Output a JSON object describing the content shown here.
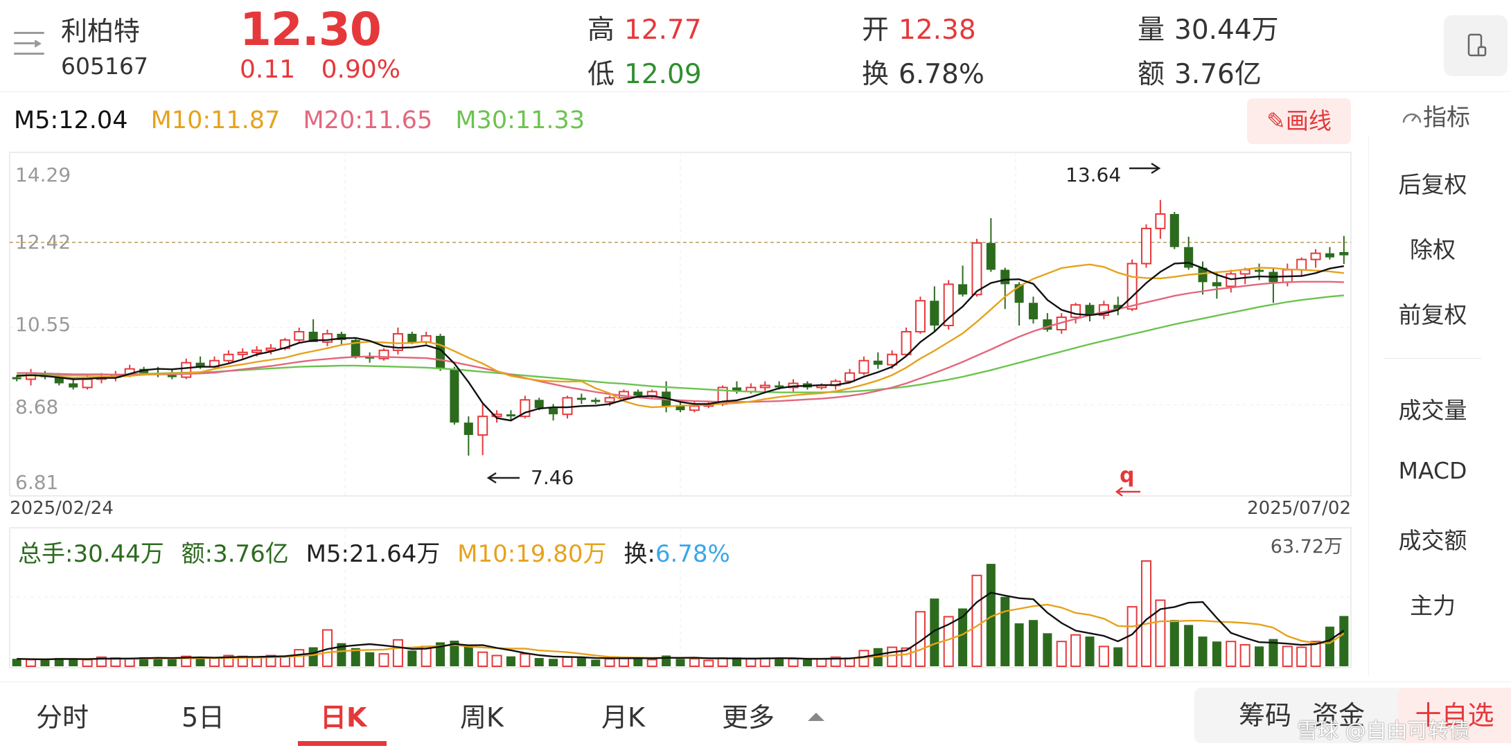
{
  "stock": {
    "name": "利柏特",
    "code": "605167",
    "price": "12.30",
    "change": "0.11",
    "change_pct": "0.90%"
  },
  "stats": {
    "high_label": "高",
    "high": "12.77",
    "low_label": "低",
    "low": "12.09",
    "open_label": "开",
    "open": "12.38",
    "turnover_label": "换",
    "turnover": "6.78%",
    "volume_label": "量",
    "volume": "30.44万",
    "amount_label": "额",
    "amount": "3.76亿"
  },
  "ma": {
    "m5": "M5:12.04",
    "m10": "M10:11.87",
    "m20": "M20:11.65",
    "m30": "M30:11.33"
  },
  "tools": {
    "draw_label": "画线",
    "index_label": "指标"
  },
  "side_panel": {
    "items": [
      "后复权",
      "除权",
      "前复权",
      "成交量",
      "MACD",
      "成交额",
      "主力"
    ],
    "active": [
      "前复权",
      "成交量"
    ]
  },
  "volume_panel": {
    "total": "总手:30.44万",
    "amount": "额:3.76亿",
    "m5": "M5:21.64万",
    "m10": "M10:19.80万",
    "turnover_label": "换:",
    "turnover_value": "6.78%",
    "max_label": "63.72万"
  },
  "tabs": [
    {
      "label": "分时"
    },
    {
      "label": "5日"
    },
    {
      "label": "日K"
    },
    {
      "label": "周K"
    },
    {
      "label": "月K"
    },
    {
      "label": "更多"
    }
  ],
  "bottom_buttons": {
    "chips": "筹码",
    "funds": "资金",
    "watchlist": "十自选"
  },
  "watermark": "雪球 @自由可转债",
  "colors": {
    "up": "#e5383b",
    "down": "#2c6b1e",
    "ma5": "#111111",
    "ma10": "#e6a21c",
    "ma20": "#e2677d",
    "ma30": "#6cc34f"
  },
  "chart_data": {
    "type": "candlestick",
    "y_ticks": [
      "14.29",
      "12.42",
      "10.55",
      "8.68",
      "6.81"
    ],
    "ylim": [
      6.81,
      14.29
    ],
    "x_labels": [
      "2025/02/24",
      "2025/07/02"
    ],
    "annotations": {
      "max": "13.64",
      "min": "7.46",
      "last_close_line": 12.42
    },
    "candles": [
      [
        9.35,
        9.4,
        9.25,
        9.3
      ],
      [
        9.3,
        9.55,
        9.15,
        9.45
      ],
      [
        9.45,
        9.5,
        9.3,
        9.35
      ],
      [
        9.35,
        9.45,
        9.15,
        9.2
      ],
      [
        9.2,
        9.35,
        9.05,
        9.1
      ],
      [
        9.1,
        9.4,
        9.05,
        9.3
      ],
      [
        9.3,
        9.45,
        9.2,
        9.35
      ],
      [
        9.35,
        9.5,
        9.25,
        9.4
      ],
      [
        9.4,
        9.65,
        9.35,
        9.55
      ],
      [
        9.55,
        9.6,
        9.4,
        9.45
      ],
      [
        9.45,
        9.6,
        9.35,
        9.4
      ],
      [
        9.4,
        9.55,
        9.3,
        9.35
      ],
      [
        9.35,
        9.8,
        9.3,
        9.7
      ],
      [
        9.7,
        9.85,
        9.55,
        9.6
      ],
      [
        9.6,
        9.85,
        9.55,
        9.75
      ],
      [
        9.75,
        10.0,
        9.7,
        9.9
      ],
      [
        9.9,
        10.05,
        9.8,
        9.95
      ],
      [
        9.95,
        10.1,
        9.85,
        10.0
      ],
      [
        10.0,
        10.15,
        9.9,
        10.05
      ],
      [
        10.05,
        10.3,
        10.0,
        10.25
      ],
      [
        10.25,
        10.55,
        10.2,
        10.45
      ],
      [
        10.45,
        10.75,
        10.2,
        10.2
      ],
      [
        10.2,
        10.5,
        10.1,
        10.4
      ],
      [
        10.4,
        10.45,
        10.15,
        10.25
      ],
      [
        10.25,
        10.3,
        9.8,
        9.85
      ],
      [
        9.85,
        9.95,
        9.7,
        9.8
      ],
      [
        9.8,
        10.05,
        9.75,
        10.0
      ],
      [
        10.0,
        10.55,
        9.9,
        10.4
      ],
      [
        10.4,
        10.45,
        10.15,
        10.2
      ],
      [
        10.2,
        10.45,
        10.15,
        10.35
      ],
      [
        10.35,
        10.4,
        9.5,
        9.55
      ],
      [
        9.55,
        9.6,
        8.2,
        8.25
      ],
      [
        8.25,
        8.4,
        7.45,
        7.95
      ],
      [
        7.95,
        8.7,
        7.46,
        8.4
      ],
      [
        8.4,
        8.55,
        8.25,
        8.45
      ],
      [
        8.45,
        8.55,
        8.3,
        8.4
      ],
      [
        8.4,
        8.9,
        8.35,
        8.8
      ],
      [
        8.8,
        8.85,
        8.55,
        8.6
      ],
      [
        8.6,
        8.7,
        8.3,
        8.45
      ],
      [
        8.45,
        8.9,
        8.35,
        8.85
      ],
      [
        8.85,
        8.95,
        8.7,
        8.8
      ],
      [
        8.8,
        8.85,
        8.7,
        8.75
      ],
      [
        8.75,
        8.9,
        8.65,
        8.85
      ],
      [
        8.85,
        9.05,
        8.8,
        9.0
      ],
      [
        9.0,
        9.05,
        8.85,
        8.9
      ],
      [
        8.9,
        9.05,
        8.85,
        9.0
      ],
      [
        9.0,
        9.25,
        8.5,
        8.65
      ],
      [
        8.65,
        8.8,
        8.5,
        8.55
      ],
      [
        8.55,
        8.75,
        8.5,
        8.65
      ],
      [
        8.65,
        8.75,
        8.6,
        8.7
      ],
      [
        8.7,
        9.15,
        8.65,
        9.1
      ],
      [
        9.1,
        9.25,
        8.95,
        9.0
      ],
      [
        9.0,
        9.2,
        8.95,
        9.1
      ],
      [
        9.1,
        9.25,
        9.0,
        9.15
      ],
      [
        9.15,
        9.25,
        9.05,
        9.1
      ],
      [
        9.1,
        9.3,
        9.0,
        9.2
      ],
      [
        9.2,
        9.25,
        9.05,
        9.1
      ],
      [
        9.1,
        9.2,
        9.05,
        9.15
      ],
      [
        9.15,
        9.3,
        9.05,
        9.25
      ],
      [
        9.25,
        9.55,
        9.2,
        9.45
      ],
      [
        9.45,
        9.85,
        9.4,
        9.75
      ],
      [
        9.75,
        9.95,
        9.55,
        9.65
      ],
      [
        9.65,
        10.0,
        9.55,
        9.9
      ],
      [
        9.9,
        10.55,
        9.85,
        10.45
      ],
      [
        10.45,
        11.3,
        10.4,
        11.2
      ],
      [
        11.2,
        11.55,
        10.45,
        10.6
      ],
      [
        10.6,
        11.7,
        10.5,
        11.6
      ],
      [
        11.6,
        12.05,
        11.3,
        11.35
      ],
      [
        11.35,
        12.7,
        11.3,
        12.6
      ],
      [
        12.6,
        13.2,
        11.9,
        11.95
      ],
      [
        11.95,
        12.0,
        11.0,
        11.6
      ],
      [
        11.6,
        11.65,
        10.6,
        11.15
      ],
      [
        11.15,
        11.3,
        10.65,
        10.75
      ],
      [
        10.75,
        10.9,
        10.45,
        10.5
      ],
      [
        10.5,
        10.9,
        10.4,
        10.8
      ],
      [
        10.8,
        11.15,
        10.65,
        11.1
      ],
      [
        11.1,
        11.15,
        10.7,
        10.85
      ],
      [
        10.85,
        11.2,
        10.75,
        11.1
      ],
      [
        11.1,
        11.3,
        10.85,
        11.0
      ],
      [
        11.0,
        12.2,
        10.95,
        12.1
      ],
      [
        12.1,
        13.05,
        12.0,
        12.95
      ],
      [
        12.95,
        13.64,
        12.7,
        13.3
      ],
      [
        13.3,
        13.35,
        12.45,
        12.5
      ],
      [
        12.5,
        12.75,
        11.95,
        12.0
      ],
      [
        12.0,
        12.15,
        11.35,
        11.65
      ],
      [
        11.65,
        11.9,
        11.25,
        11.55
      ],
      [
        11.55,
        11.95,
        11.4,
        11.85
      ],
      [
        11.85,
        12.0,
        11.6,
        11.95
      ],
      [
        11.95,
        12.1,
        11.7,
        11.9
      ],
      [
        11.9,
        12.0,
        11.15,
        11.65
      ],
      [
        11.65,
        12.1,
        11.55,
        11.95
      ],
      [
        11.95,
        12.25,
        11.8,
        12.2
      ],
      [
        12.2,
        12.45,
        12.0,
        12.35
      ],
      [
        12.35,
        12.5,
        12.2,
        12.25
      ],
      [
        12.38,
        12.77,
        12.09,
        12.3
      ]
    ],
    "ma5": [
      9.38,
      9.4,
      9.38,
      9.34,
      9.3,
      9.31,
      9.33,
      9.33,
      9.43,
      9.52,
      9.55,
      9.54,
      9.57,
      9.6,
      9.6,
      9.68,
      9.78,
      9.9,
      9.97,
      10.06,
      10.18,
      10.24,
      10.25,
      10.29,
      10.3,
      10.23,
      10.1,
      10.06,
      10.07,
      10.12,
      10.02,
      9.68,
      9.23,
      8.72,
      8.36,
      8.3,
      8.49,
      8.59,
      8.62,
      8.62,
      8.65,
      8.66,
      8.7,
      8.8,
      8.88,
      8.89,
      8.84,
      8.75,
      8.7,
      8.7,
      8.76,
      8.79,
      8.87,
      8.98,
      9.08,
      9.13,
      9.14,
      9.16,
      9.16,
      9.22,
      9.36,
      9.47,
      9.6,
      9.86,
      10.2,
      10.45,
      10.78,
      11.06,
      11.43,
      11.63,
      11.71,
      11.72,
      11.61,
      11.22,
      10.98,
      10.88,
      10.85,
      10.89,
      10.98,
      11.3,
      11.63,
      11.9,
      12.1,
      12.12,
      11.99,
      11.83,
      11.72,
      11.76,
      11.79,
      11.78,
      11.79,
      11.8,
      11.87,
      11.98,
      12.04
    ],
    "ma10": [
      9.38,
      9.39,
      9.38,
      9.36,
      9.34,
      9.35,
      9.36,
      9.36,
      9.38,
      9.41,
      9.43,
      9.44,
      9.45,
      9.47,
      9.55,
      9.61,
      9.66,
      9.72,
      9.77,
      9.82,
      9.91,
      9.98,
      10.05,
      10.13,
      10.18,
      10.21,
      10.19,
      10.17,
      10.18,
      10.21,
      10.13,
      9.98,
      9.82,
      9.68,
      9.5,
      9.38,
      9.32,
      9.27,
      9.25,
      9.24,
      9.25,
      9.08,
      8.96,
      8.77,
      8.67,
      8.62,
      8.64,
      8.66,
      8.67,
      8.68,
      8.71,
      8.72,
      8.76,
      8.82,
      8.87,
      8.91,
      8.94,
      8.96,
      9.01,
      9.08,
      9.17,
      9.27,
      9.4,
      9.58,
      9.8,
      9.99,
      10.2,
      10.41,
      10.69,
      10.99,
      11.3,
      11.55,
      11.73,
      11.86,
      11.99,
      12.04,
      12.08,
      12.02,
      11.88,
      11.78,
      11.75,
      11.74,
      11.78,
      11.83,
      11.86,
      11.89,
      11.92,
      11.96,
      12.0,
      11.99,
      11.96,
      11.95,
      11.93,
      11.91,
      11.87
    ],
    "ma20": [
      9.45,
      9.45,
      9.44,
      9.43,
      9.42,
      9.42,
      9.42,
      9.41,
      9.41,
      9.41,
      9.42,
      9.42,
      9.43,
      9.44,
      9.46,
      9.5,
      9.54,
      9.58,
      9.62,
      9.67,
      9.72,
      9.76,
      9.79,
      9.82,
      9.84,
      9.85,
      9.84,
      9.83,
      9.82,
      9.81,
      9.77,
      9.71,
      9.64,
      9.57,
      9.49,
      9.41,
      9.33,
      9.25,
      9.18,
      9.11,
      9.05,
      8.99,
      8.94,
      8.9,
      8.86,
      8.83,
      8.81,
      8.79,
      8.77,
      8.76,
      8.75,
      8.75,
      8.75,
      8.76,
      8.77,
      8.79,
      8.81,
      8.83,
      8.86,
      8.9,
      8.95,
      9.02,
      9.1,
      9.2,
      9.32,
      9.45,
      9.58,
      9.72,
      9.87,
      10.02,
      10.18,
      10.33,
      10.46,
      10.57,
      10.67,
      10.76,
      10.85,
      10.93,
      11.0,
      11.08,
      11.16,
      11.24,
      11.32,
      11.38,
      11.43,
      11.48,
      11.52,
      11.56,
      11.6,
      11.63,
      11.65,
      11.66,
      11.66,
      11.66,
      11.65
    ],
    "ma30": [
      9.4,
      9.4,
      9.4,
      9.4,
      9.4,
      9.4,
      9.41,
      9.41,
      9.42,
      9.43,
      9.44,
      9.45,
      9.46,
      9.47,
      9.48,
      9.5,
      9.52,
      9.54,
      9.56,
      9.58,
      9.6,
      9.61,
      9.62,
      9.63,
      9.63,
      9.62,
      9.61,
      9.6,
      9.59,
      9.58,
      9.56,
      9.54,
      9.51,
      9.48,
      9.45,
      9.42,
      9.39,
      9.36,
      9.33,
      9.3,
      9.27,
      9.24,
      9.21,
      9.19,
      9.16,
      9.13,
      9.11,
      9.09,
      9.07,
      9.05,
      9.03,
      9.01,
      9.0,
      8.99,
      8.98,
      8.98,
      8.98,
      8.98,
      8.99,
      9.0,
      9.02,
      9.05,
      9.08,
      9.12,
      9.17,
      9.23,
      9.29,
      9.36,
      9.44,
      9.52,
      9.61,
      9.7,
      9.79,
      9.88,
      9.97,
      10.06,
      10.15,
      10.23,
      10.31,
      10.39,
      10.47,
      10.55,
      10.63,
      10.7,
      10.77,
      10.84,
      10.91,
      10.98,
      11.05,
      11.11,
      11.17,
      11.22,
      11.26,
      11.3,
      11.33
    ],
    "volume": [
      4.5,
      4.0,
      4.2,
      5.0,
      4.5,
      4.0,
      5.5,
      5.0,
      4.5,
      5.5,
      5.0,
      4.5,
      6.0,
      5.5,
      5.0,
      6.5,
      6.0,
      5.5,
      6.5,
      6.0,
      10.0,
      11.5,
      22.0,
      14.0,
      11.0,
      8.5,
      7.5,
      16.0,
      9.5,
      12.0,
      14.5,
      15.5,
      12.0,
      8.5,
      6.5,
      6.0,
      7.5,
      5.0,
      4.5,
      5.5,
      5.0,
      4.0,
      4.5,
      5.0,
      5.5,
      4.0,
      6.5,
      4.5,
      4.5,
      3.5,
      5.0,
      5.5,
      4.5,
      5.0,
      4.5,
      4.5,
      4.0,
      4.5,
      5.5,
      5.0,
      9.5,
      11.0,
      11.5,
      11.0,
      33.0,
      41.0,
      30.0,
      35.0,
      55.0,
      62.0,
      42.0,
      26.0,
      28.0,
      20.0,
      15.0,
      19.0,
      18.0,
      12.0,
      11.5,
      36.0,
      63.72,
      40.0,
      28.0,
      25.0,
      18.0,
      15.0,
      15.0,
      13.0,
      12.0,
      16.5,
      12.0,
      11.5,
      15.0,
      24.0,
      30.44
    ],
    "vol_m5": [
      4.5,
      4.3,
      4.2,
      4.4,
      4.4,
      4.3,
      4.6,
      4.6,
      4.7,
      4.9,
      5.1,
      5.0,
      5.2,
      5.4,
      5.2,
      5.5,
      5.7,
      5.7,
      5.9,
      6.1,
      7.0,
      7.9,
      10.4,
      11.9,
      12.7,
      13.4,
      12.6,
      11.6,
      10.5,
      10.7,
      11.9,
      13.5,
      12.7,
      12.8,
      11.1,
      9.7,
      8.0,
      6.7,
      5.9,
      5.7,
      5.5,
      5.0,
      4.9,
      4.8,
      4.9,
      4.8,
      5.1,
      5.1,
      5.2,
      4.8,
      4.8,
      4.7,
      4.6,
      4.7,
      4.9,
      4.8,
      4.5,
      4.5,
      4.6,
      4.7,
      5.7,
      7.1,
      8.5,
      9.6,
      15.2,
      21.5,
      25.3,
      30.0,
      38.8,
      44.6,
      42.8,
      41.2,
      40.6,
      32.4,
      26.2,
      21.6,
      20.0,
      18.4,
      15.1,
      19.3,
      28.2,
      34.6,
      35.9,
      38.5,
      38.9,
      29.2,
      20.2,
      17.2,
      14.6,
      14.3,
      13.7,
      12.9,
      13.4,
      15.8,
      21.64
    ],
    "vol_m10": [
      4.5,
      4.3,
      4.2,
      4.4,
      4.4,
      4.4,
      4.5,
      4.6,
      4.6,
      4.6,
      4.7,
      4.7,
      4.8,
      4.9,
      4.9,
      5.0,
      5.1,
      5.2,
      5.4,
      5.6,
      6.2,
      6.8,
      8.4,
      9.1,
      9.7,
      9.9,
      10.1,
      11.1,
      11.4,
      11.9,
      12.3,
      12.9,
      11.9,
      11.4,
      11.0,
      10.7,
      10.7,
      9.6,
      9.1,
      8.5,
      7.6,
      6.5,
      5.7,
      5.4,
      5.3,
      5.1,
      5.1,
      5.0,
      5.0,
      4.8,
      4.8,
      4.9,
      4.8,
      4.8,
      4.8,
      4.9,
      4.6,
      4.6,
      4.8,
      4.9,
      5.3,
      5.9,
      6.6,
      7.2,
      10.0,
      13.6,
      16.2,
      19.3,
      24.3,
      30.0,
      33.3,
      34.8,
      36.4,
      37.3,
      35.5,
      32.3,
      31.1,
      28.8,
      24.4,
      24.1,
      25.7,
      27.2,
      27.2,
      27.6,
      27.6,
      27.0,
      26.7,
      26.2,
      25.3,
      23.4,
      18.3,
      15.4,
      14.1,
      14.0,
      19.8
    ]
  }
}
